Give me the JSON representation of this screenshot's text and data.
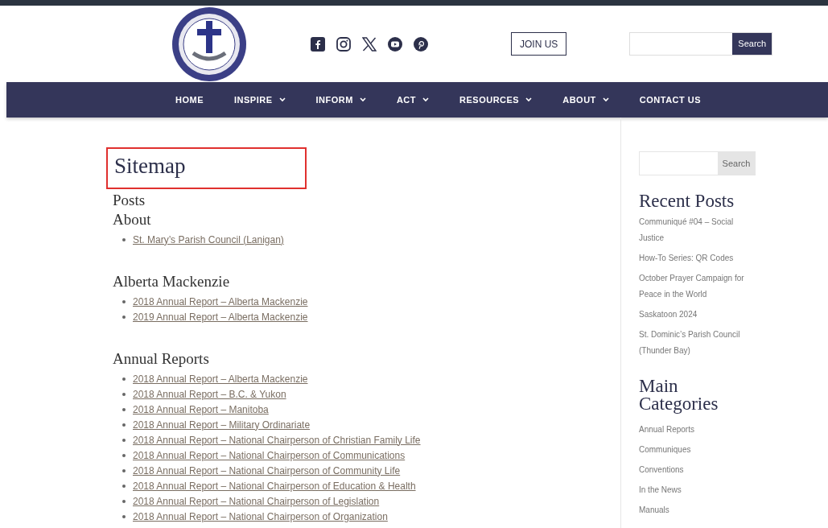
{
  "header": {
    "join_button": "JOIN US",
    "search": {
      "button": "Search"
    }
  },
  "nav": [
    {
      "label": "HOME",
      "has_menu": false
    },
    {
      "label": "INSPIRE",
      "has_menu": true
    },
    {
      "label": "INFORM",
      "has_menu": true
    },
    {
      "label": "ACT",
      "has_menu": true
    },
    {
      "label": "RESOURCES",
      "has_menu": true
    },
    {
      "label": "ABOUT",
      "has_menu": true
    },
    {
      "label": "CONTACT US",
      "has_menu": false
    }
  ],
  "page": {
    "title": "Sitemap",
    "title_highlighted": true,
    "subtitle": "Posts",
    "sections": [
      {
        "heading": "About",
        "links": [
          "St. Mary’s Parish Council (Lanigan)"
        ]
      },
      {
        "heading": "Alberta Mackenzie",
        "links": [
          "2018 Annual Report – Alberta Mackenzie",
          "2019 Annual Report – Alberta Mackenzie"
        ]
      },
      {
        "heading": "Annual Reports",
        "links": [
          "2018 Annual Report – Alberta Mackenzie",
          "2018 Annual Report – B.C. & Yukon",
          "2018 Annual Report – Manitoba",
          "2018 Annual Report – Military Ordinariate",
          "2018 Annual Report – National Chairperson of Christian Family Life",
          "2018 Annual Report – National Chairperson of Communications",
          "2018 Annual Report – National Chairperson of Community Life",
          "2018 Annual Report – National Chairperson of Education & Health",
          "2018 Annual Report – National Chairperson of Legislation",
          "2018 Annual Report – National Chairperson of Organization"
        ]
      }
    ]
  },
  "sidebar": {
    "search": {
      "button": "Search"
    },
    "recent_posts": {
      "heading": "Recent Posts",
      "items": [
        "Communiqué #04 – Social Justice",
        "How-To Series: QR Codes",
        "October Prayer Campaign for Peace in the World",
        "Saskatoon 2024",
        "St. Dominic’s Parish Council (Thunder Bay)"
      ]
    },
    "categories": {
      "heading": "Main Categories",
      "items": [
        "Annual Reports",
        "Communiques",
        "Conventions",
        "In the News",
        "Manuals"
      ]
    }
  }
}
